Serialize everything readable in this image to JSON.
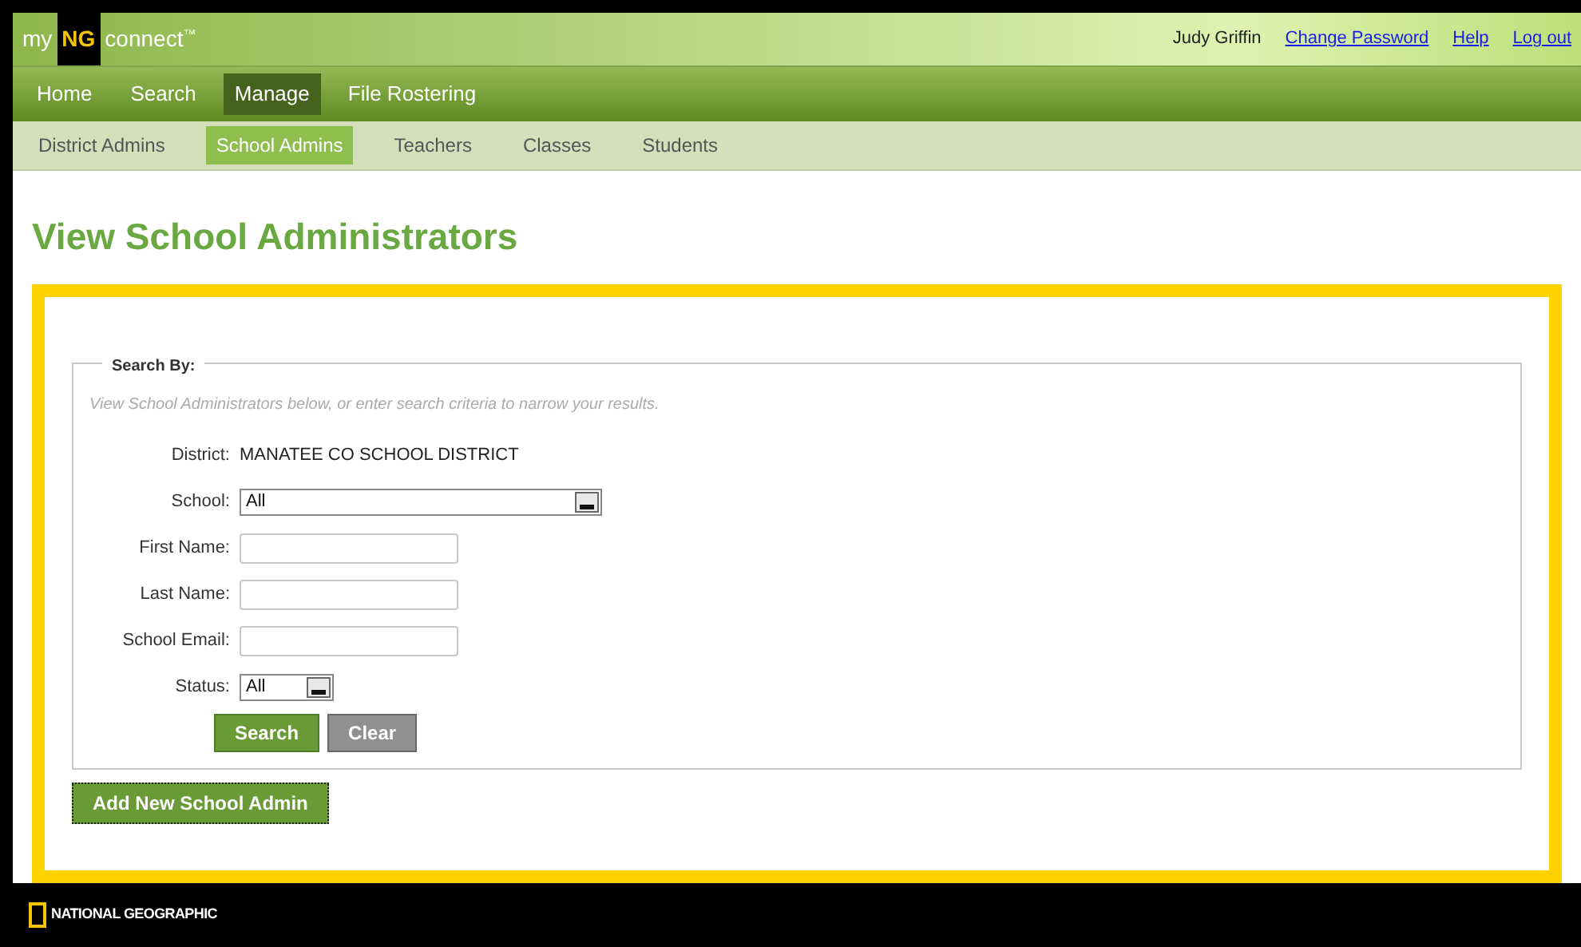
{
  "logo": {
    "prefix": "my",
    "mark": "NG",
    "suffix": "connect",
    "trademark": "™"
  },
  "user": {
    "name": "Judy Griffin",
    "links": [
      "Change Password",
      "Help",
      "Log out"
    ]
  },
  "main_nav": [
    {
      "label": "Home",
      "selected": false
    },
    {
      "label": "Search",
      "selected": false
    },
    {
      "label": "Manage",
      "selected": true
    },
    {
      "label": "File Rostering",
      "selected": false
    }
  ],
  "sub_nav": [
    {
      "label": "District Admins",
      "selected": false
    },
    {
      "label": "School Admins",
      "selected": true
    },
    {
      "label": "Teachers",
      "selected": false
    },
    {
      "label": "Classes",
      "selected": false
    },
    {
      "label": "Students",
      "selected": false
    }
  ],
  "page_title": "View School Administrators",
  "search_form": {
    "legend": "Search By:",
    "hint": "View School Administrators below, or enter search criteria to narrow your results.",
    "fields": [
      {
        "kind": "text",
        "label": "District:",
        "value": "MANATEE CO SCHOOL DISTRICT"
      },
      {
        "kind": "wide_select",
        "label": "School:",
        "value": "All"
      },
      {
        "kind": "input",
        "label": "First Name:"
      },
      {
        "kind": "input",
        "label": "Last Name:"
      },
      {
        "kind": "input",
        "label": "School Email:"
      },
      {
        "kind": "select",
        "label": "Status:",
        "value": "All"
      }
    ],
    "buttons": [
      {
        "label": "Search",
        "kind": "primary"
      },
      {
        "label": "Clear",
        "kind": "secondary"
      }
    ]
  },
  "add_button": "Add New School Admin",
  "footer": {
    "brand": "NATIONAL GEOGRAPHIC"
  }
}
